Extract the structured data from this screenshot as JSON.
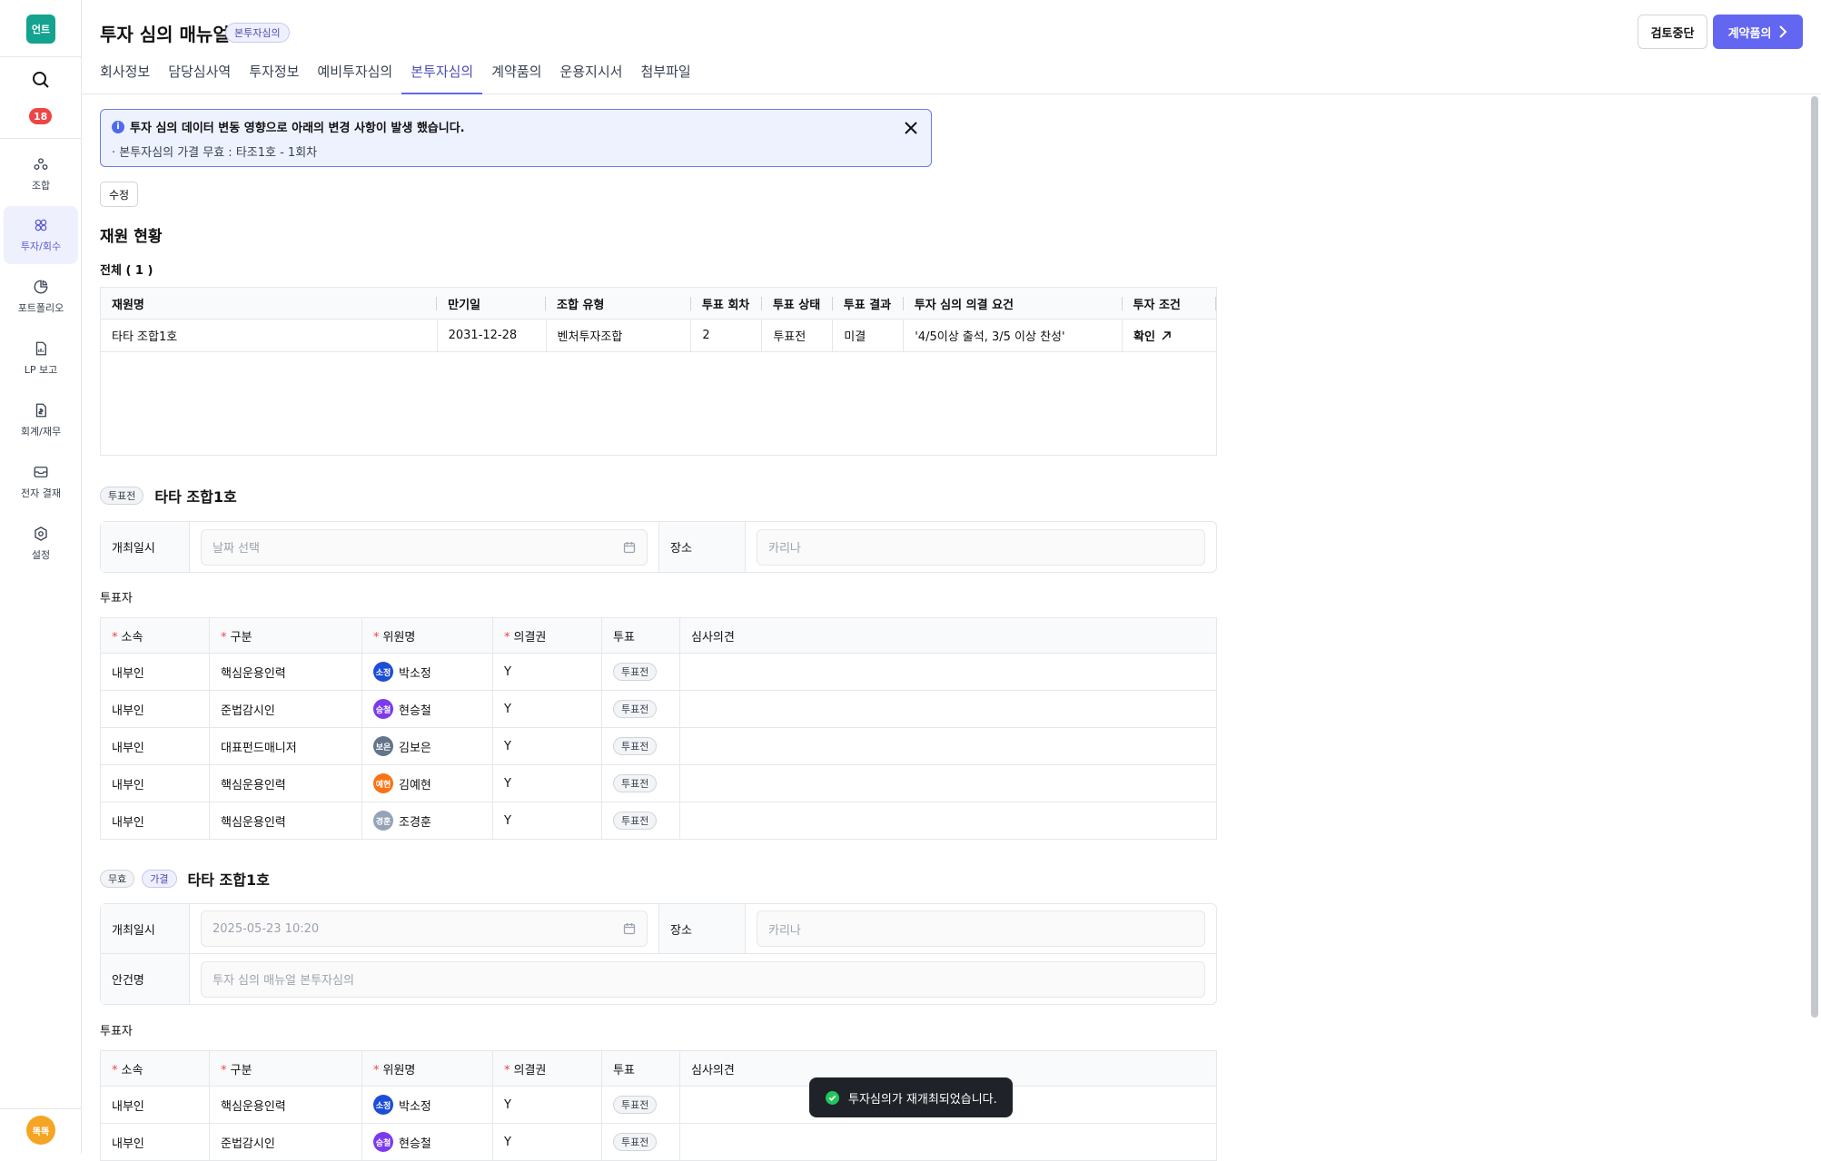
{
  "sidebar": {
    "logo": "언트",
    "badge_count": "18",
    "items": [
      {
        "label": "조합",
        "icon": "fund-icon"
      },
      {
        "label": "투자/회수",
        "icon": "investment-icon",
        "active": true
      },
      {
        "label": "포트폴리오",
        "icon": "portfolio-icon"
      },
      {
        "label": "LP 보고",
        "icon": "lp-report-icon"
      },
      {
        "label": "회계/재무",
        "icon": "accounting-icon"
      },
      {
        "label": "전자 결재",
        "icon": "approval-icon"
      },
      {
        "label": "설정",
        "icon": "settings-icon"
      }
    ],
    "avatar": "똑똑"
  },
  "header": {
    "title": "투자 심의 매뉴얼",
    "badge": "본투자심의",
    "btn_stop": "검토중단",
    "btn_contract": "계약품의"
  },
  "tabs": [
    "회사정보",
    "담당심사역",
    "투자정보",
    "예비투자심의",
    "본투자심의",
    "계약품의",
    "운용지시서",
    "첨부파일"
  ],
  "notice": {
    "title": "투자 심의 데이터 변동 영향으로 아래의 변경 사항이 발생 했습니다.",
    "detail": "· 본투자심의 가결 무효 : 타조1호 - 1회차"
  },
  "edit_label": "수정",
  "fund_section": {
    "title": "재원 현황",
    "count_label": "전체 ( 1 )",
    "columns": [
      "재원명",
      "만기일",
      "조합 유형",
      "투표 회차",
      "투표 상태",
      "투표 결과",
      "투자 심의 의결 요건",
      "투자 조건"
    ],
    "rows": [
      [
        "타타 조합1호",
        "2031-12-28",
        "벤처투자조합",
        "2",
        "투표전",
        "미결",
        "'4/5이상 출석, 3/5 이상 찬성'",
        "확인"
      ]
    ]
  },
  "meeting1": {
    "tag": "투표전",
    "name": "타타 조합1호",
    "date_label": "개최일시",
    "date_placeholder": "날짜 선택",
    "place_label": "장소",
    "place_placeholder": "카리나",
    "voters_label": "투표자"
  },
  "voter_columns": [
    "소속",
    "구분",
    "위원명",
    "의결권",
    "투표",
    "심사의견"
  ],
  "voters1": [
    {
      "org": "내부인",
      "type": "핵심운용인력",
      "initials": "소정",
      "name": "박소정",
      "color": "#1d4ed8",
      "right": "Y",
      "vote": "투표전"
    },
    {
      "org": "내부인",
      "type": "준법감시인",
      "initials": "승철",
      "name": "현승철",
      "color": "#7c3aed",
      "right": "Y",
      "vote": "투표전"
    },
    {
      "org": "내부인",
      "type": "대표펀드매니저",
      "initials": "보은",
      "name": "김보은",
      "color": "#64748b",
      "right": "Y",
      "vote": "투표전"
    },
    {
      "org": "내부인",
      "type": "핵심운용인력",
      "initials": "예현",
      "name": "김예현",
      "color": "#f97316",
      "right": "Y",
      "vote": "투표전"
    },
    {
      "org": "내부인",
      "type": "핵심운용인력",
      "initials": "경훈",
      "name": "조경훈",
      "color": "#94a3b8",
      "right": "Y",
      "vote": "투표전"
    }
  ],
  "meeting2": {
    "tag1": "무효",
    "tag2": "가결",
    "name": "타타 조합1호",
    "date_label": "개최일시",
    "date_value": "2025-05-23 10:20",
    "place_label": "장소",
    "place_placeholder": "카리나",
    "agenda_label": "안건명",
    "agenda_placeholder": "투자 심의 매뉴얼 본투자심의",
    "voters_label": "투표자"
  },
  "voters2": [
    {
      "org": "내부인",
      "type": "핵심운용인력",
      "initials": "소정",
      "name": "박소정",
      "color": "#1d4ed8",
      "right": "Y",
      "vote": "투표전"
    },
    {
      "org": "내부인",
      "type": "준법감시인",
      "initials": "승철",
      "name": "현승철",
      "color": "#7c3aed",
      "right": "Y",
      "vote": "투표전"
    }
  ],
  "toast": "투자심의가 재개최되었습니다."
}
